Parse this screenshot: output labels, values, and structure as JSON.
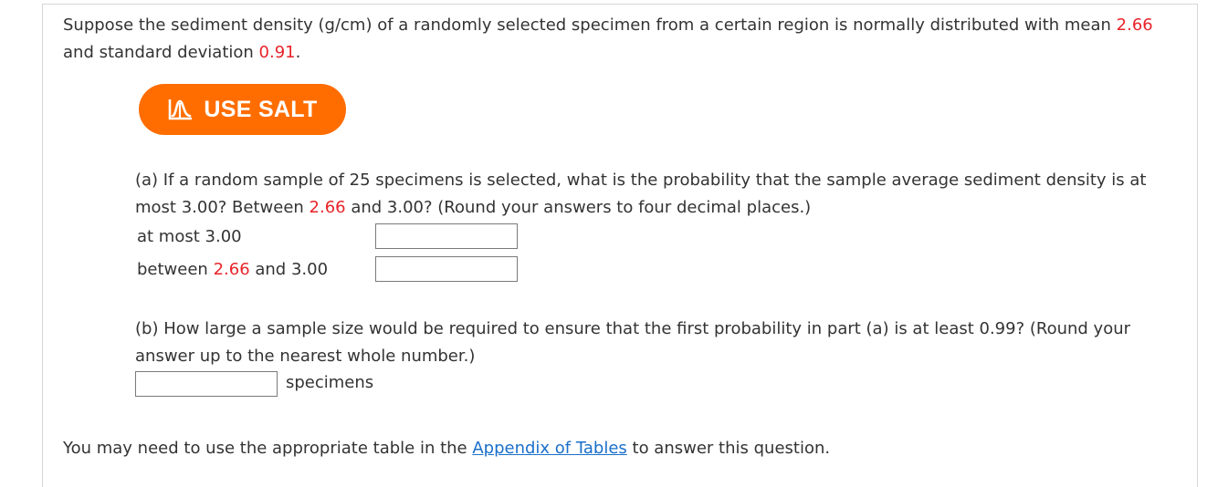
{
  "intro": {
    "text_1": "Suppose the sediment density (g/cm) of a randomly selected specimen from a certain region is normally distributed with mean ",
    "mean": "2.66",
    "text_2": " and standard deviation ",
    "sd": "0.91",
    "text_3": "."
  },
  "salt_button": {
    "label": "USE SALT",
    "icon": "bell-curve-icon"
  },
  "part_a": {
    "text_1": "(a) If a random sample of 25 specimens is selected, what is the probability that the sample average sediment density is at most 3.00? Between ",
    "value": "2.66",
    "text_2": " and 3.00? (Round your answers to four decimal places.)",
    "row1_label": "at most 3.00",
    "row1_value": "",
    "row2_prefix": "between ",
    "row2_value_red": "2.66",
    "row2_suffix": " and 3.00",
    "row2_value": ""
  },
  "part_b": {
    "text": "(b) How large a sample size would be required to ensure that the first probability in part (a) is at least 0.99? (Round your answer up to the nearest whole number.)",
    "answer_value": "",
    "unit": "specimens"
  },
  "footer": {
    "text_1": "You may need to use the appropriate table in the ",
    "link": "Appendix of Tables",
    "text_2": " to answer this question."
  },
  "colors": {
    "accent_orange": "#ff6d00",
    "highlight_red": "#e8232a",
    "link_blue": "#1a6fc9"
  }
}
